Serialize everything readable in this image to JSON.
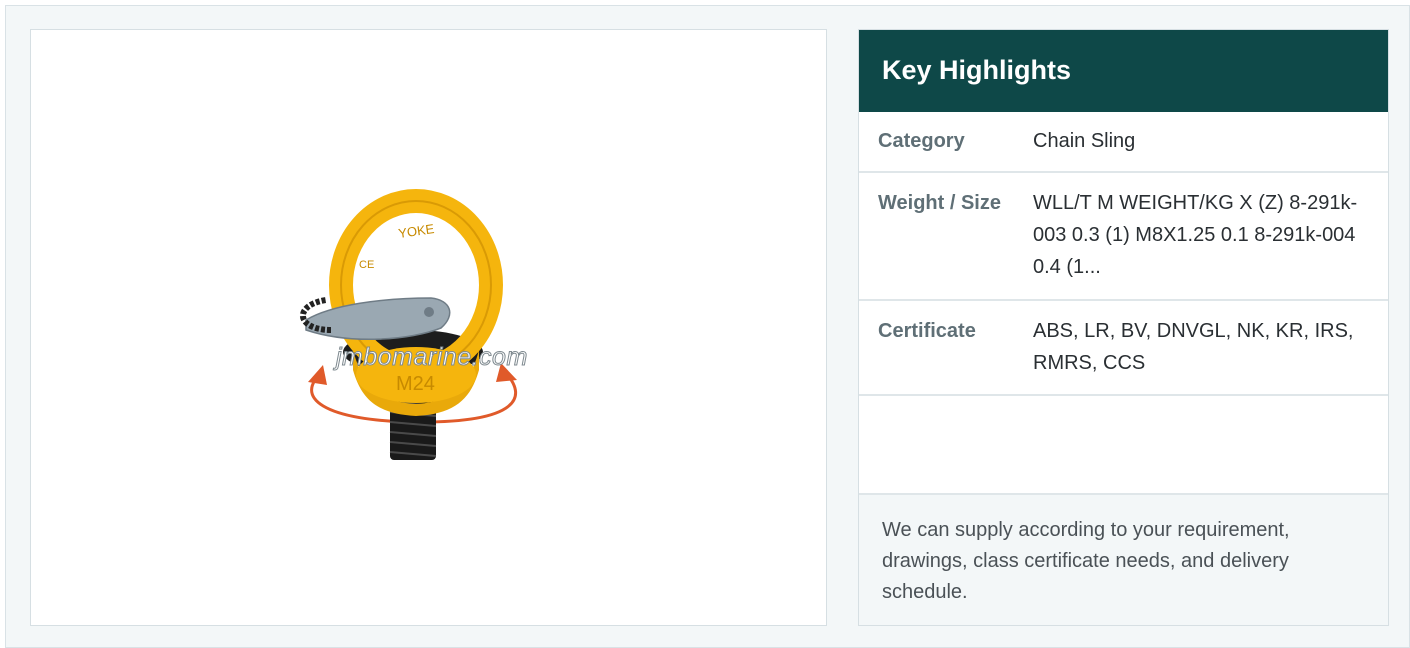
{
  "product": {
    "image_alt": "Rotating eye bolt M24",
    "image_marks": [
      "YOKE",
      "M24",
      "CE"
    ],
    "watermark": "jmbomarine.com"
  },
  "highlights": {
    "title": "Key Highlights",
    "rows": [
      {
        "label": "Category",
        "value": "Chain Sling"
      },
      {
        "label": "Weight / Size",
        "value": "WLL/T M WEIGHT/KG X (Z) 8-291k-003 0.3 (1) M8X1.25 0.1 8-291k-004 0.4 (1..."
      },
      {
        "label": "Certificate",
        "value": "ABS, LR, BV, DNVGL, NK, KR, IRS, RMRS, CCS"
      }
    ],
    "note": "We can supply according to your requirement, drawings, class certificate needs, and delivery schedule."
  },
  "colors": {
    "header_bg": "#0e4848",
    "page_bg": "#f3f7f8",
    "label": "#5f6f76",
    "eye_bolt_yellow": "#f5b50d",
    "arrow_orange": "#e05a2a"
  }
}
